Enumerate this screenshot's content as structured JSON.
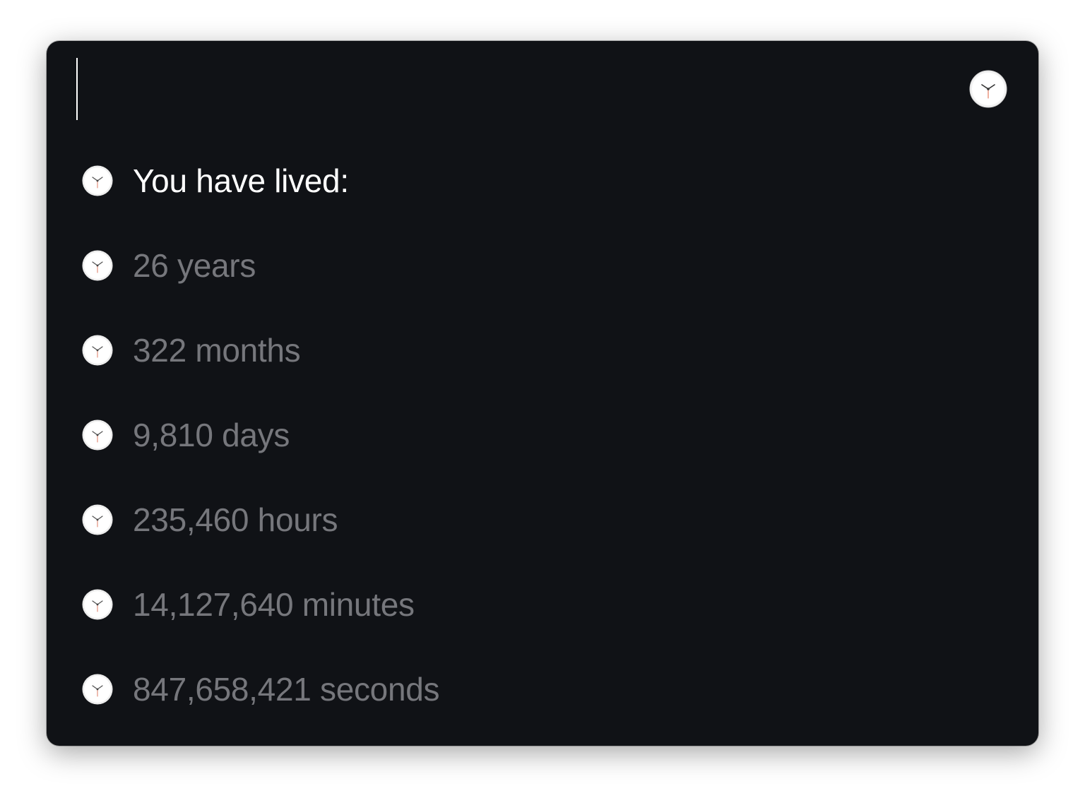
{
  "search": {
    "value": "",
    "placeholder": ""
  },
  "app_icon": "clock-icon",
  "results": {
    "header": "You have lived:",
    "items": [
      "26 years",
      "322 months",
      "9,810 days",
      "235,460 hours",
      "14,127,640 minutes",
      "847,658,421 seconds"
    ]
  },
  "colors": {
    "window_bg": "#101216",
    "header_text": "#ffffff",
    "item_text": "#76777c"
  }
}
